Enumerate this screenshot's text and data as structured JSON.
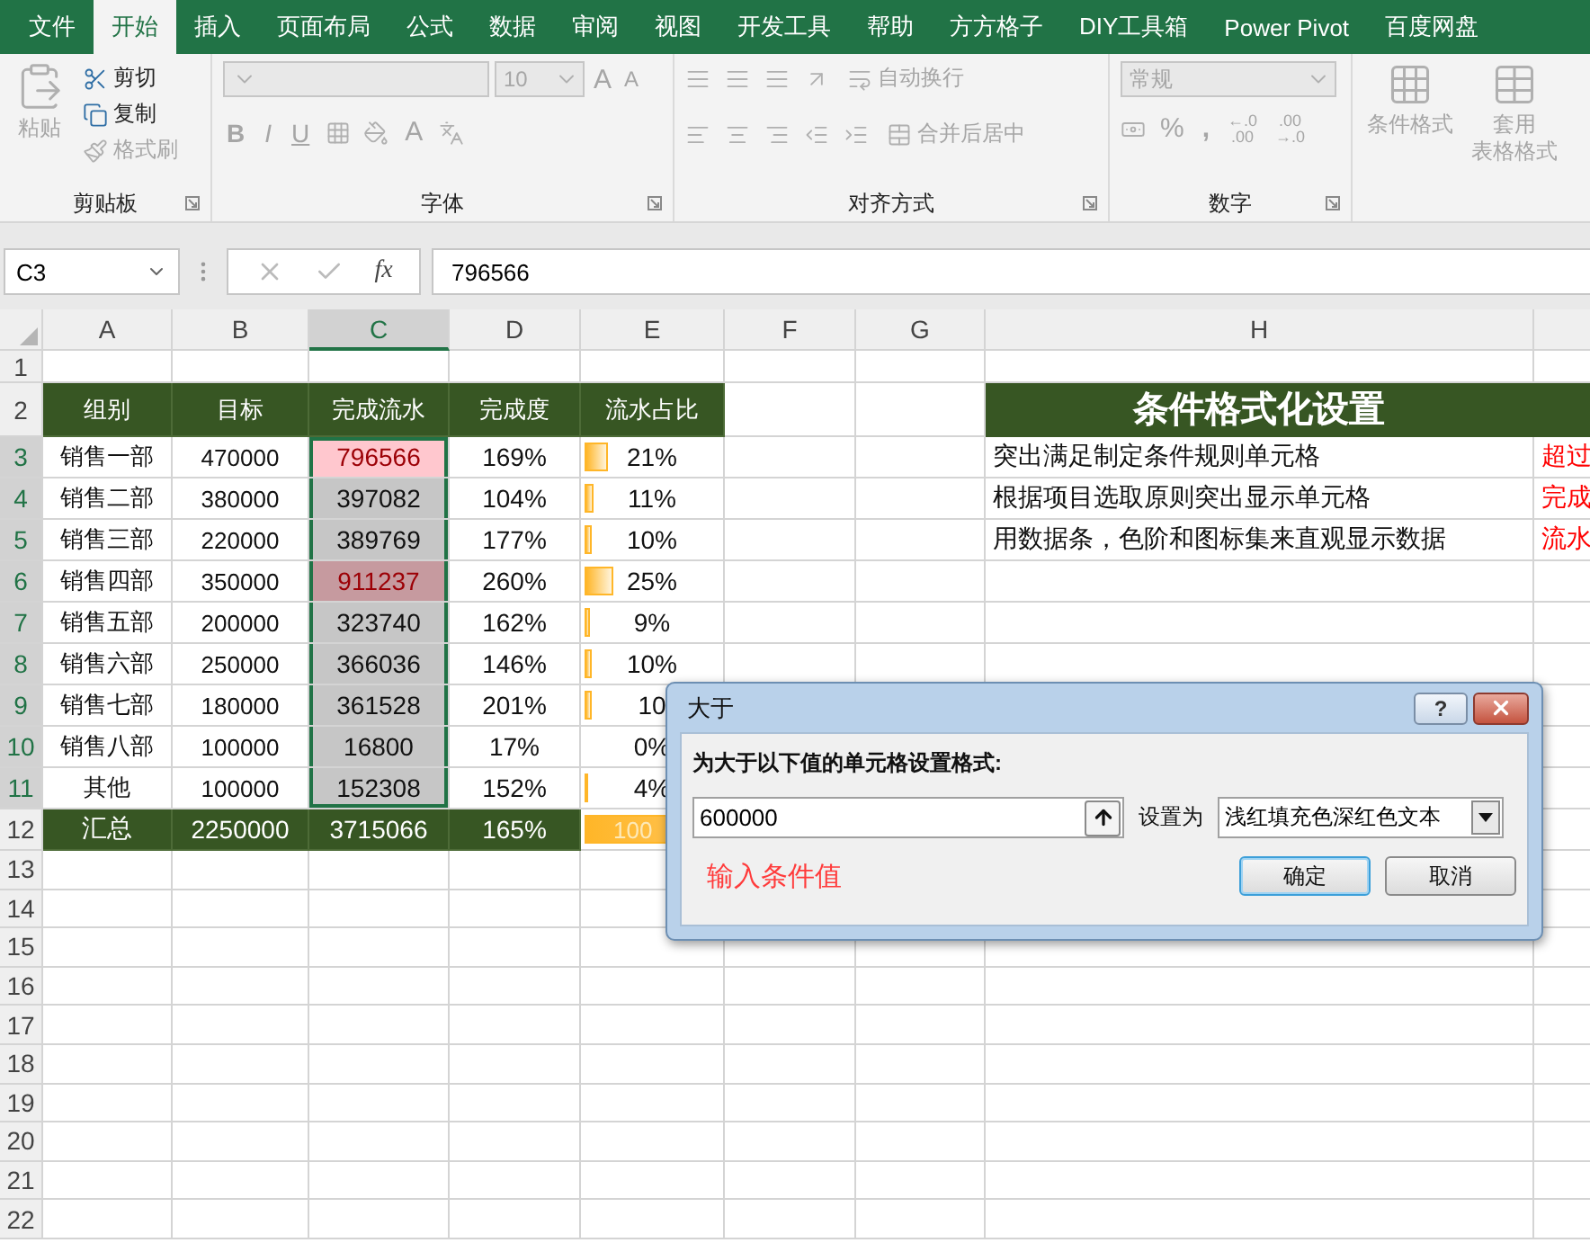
{
  "ribbon_tabs": [
    {
      "label": "文件",
      "selected": false
    },
    {
      "label": "开始",
      "selected": true
    },
    {
      "label": "插入",
      "selected": false
    },
    {
      "label": "页面布局",
      "selected": false
    },
    {
      "label": "公式",
      "selected": false
    },
    {
      "label": "数据",
      "selected": false
    },
    {
      "label": "审阅",
      "selected": false
    },
    {
      "label": "视图",
      "selected": false
    },
    {
      "label": "开发工具",
      "selected": false
    },
    {
      "label": "帮助",
      "selected": false
    },
    {
      "label": "方方格子",
      "selected": false
    },
    {
      "label": "DIY工具箱",
      "selected": false
    },
    {
      "label": "Power Pivot",
      "selected": false
    },
    {
      "label": "百度网盘",
      "selected": false
    }
  ],
  "ribbon": {
    "clipboard": {
      "title": "剪贴板",
      "paste": {
        "label": "粘贴",
        "disabled": true
      },
      "actions": [
        {
          "kind": "cut",
          "label": "剪切",
          "disabled": false
        },
        {
          "kind": "copy",
          "label": "复制",
          "disabled": false
        },
        {
          "kind": "painter",
          "label": "格式刷",
          "disabled": true
        }
      ]
    },
    "font": {
      "title": "字体",
      "size": "10",
      "grow": "A",
      "shrink": "A",
      "styles": [
        "B",
        "I",
        "U"
      ],
      "font_color": "A"
    },
    "alignment": {
      "title": "对齐方式",
      "wrap": "自动换行",
      "merge": "合并后居中"
    },
    "number": {
      "title": "数字",
      "format": "常规",
      "percent": "%",
      "comma": ",",
      "decimals": [
        {
          "top": "←.0",
          "bottom": ".00"
        },
        {
          "top": ".00",
          "bottom": "→.0"
        }
      ]
    },
    "styles": [
      {
        "kind": "conditional",
        "lines": [
          "条件格式"
        ]
      },
      {
        "kind": "table",
        "lines": [
          "套用",
          "表格格式"
        ]
      }
    ]
  },
  "name_box": "C3",
  "formula": {
    "fx": "fx",
    "value": "796566"
  },
  "sheet": {
    "columns": [
      {
        "label": "A",
        "selected": false
      },
      {
        "label": "B",
        "selected": false
      },
      {
        "label": "C",
        "selected": true
      },
      {
        "label": "D",
        "selected": false
      },
      {
        "label": "E",
        "selected": false
      },
      {
        "label": "F",
        "selected": false
      },
      {
        "label": "G",
        "selected": false
      },
      {
        "label": "H",
        "selected": false
      }
    ],
    "rows": [
      {
        "number": "1",
        "kind": "empty",
        "selected": false
      },
      {
        "number": "2",
        "kind": "header",
        "selected": false,
        "cells": [
          "组别",
          "目标",
          "完成流水",
          "完成度",
          "流水占比"
        ],
        "h": "条件格式化设置"
      },
      {
        "number": "3",
        "kind": "data",
        "selected": true,
        "a": "销售一部",
        "b": "470000",
        "c": {
          "text": "796566",
          "highlight": true,
          "active": true
        },
        "d": "169%",
        "e": {
          "text": "21%",
          "level": 0.21
        },
        "h": "突出满足制定条件规则单元格",
        "i": "超过"
      },
      {
        "number": "4",
        "kind": "data",
        "selected": true,
        "a": "销售二部",
        "b": "380000",
        "c": {
          "text": "397082",
          "highlight": false,
          "active": false
        },
        "d": "104%",
        "e": {
          "text": "11%",
          "level": 0.11
        },
        "h": "根据项目选取原则突出显示单元格",
        "i": "完成"
      },
      {
        "number": "5",
        "kind": "data",
        "selected": true,
        "a": "销售三部",
        "b": "220000",
        "c": {
          "text": "389769",
          "highlight": false,
          "active": false
        },
        "d": "177%",
        "e": {
          "text": "10%",
          "level": 0.1
        },
        "h": "用数据条，色阶和图标集来直观显示数据",
        "i": "流水"
      },
      {
        "number": "6",
        "kind": "data",
        "selected": true,
        "a": "销售四部",
        "b": "350000",
        "c": {
          "text": "911237",
          "highlight": true,
          "active": false
        },
        "d": "260%",
        "e": {
          "text": "25%",
          "level": 0.25
        }
      },
      {
        "number": "7",
        "kind": "data",
        "selected": true,
        "a": "销售五部",
        "b": "200000",
        "c": {
          "text": "323740",
          "highlight": false,
          "active": false
        },
        "d": "162%",
        "e": {
          "text": "9%",
          "level": 0.09
        }
      },
      {
        "number": "8",
        "kind": "data",
        "selected": true,
        "a": "销售六部",
        "b": "250000",
        "c": {
          "text": "366036",
          "highlight": false,
          "active": false
        },
        "d": "146%",
        "e": {
          "text": "10%",
          "level": 0.1
        }
      },
      {
        "number": "9",
        "kind": "data",
        "selected": true,
        "a": "销售七部",
        "b": "180000",
        "c": {
          "text": "361528",
          "highlight": false,
          "active": false
        },
        "d": "201%",
        "e": {
          "text": "10",
          "level": 0.1
        }
      },
      {
        "number": "10",
        "kind": "data",
        "selected": true,
        "a": "销售八部",
        "b": "100000",
        "c": {
          "text": "16800",
          "highlight": false,
          "active": false
        },
        "d": "17%",
        "e": {
          "text": "0%"
        }
      },
      {
        "number": "11",
        "kind": "data",
        "selected": true,
        "a": "其他",
        "b": "100000",
        "c": {
          "text": "152308",
          "highlight": false,
          "active": false
        },
        "d": "152%",
        "e": {
          "text": "4%",
          "level": 0.04
        }
      },
      {
        "number": "12",
        "kind": "total",
        "selected": false,
        "cells": [
          "汇总",
          "2250000",
          "3715066",
          "165%"
        ],
        "e": {
          "text": "100",
          "level": 1
        }
      },
      {
        "number": "13",
        "kind": "empty",
        "selected": false
      },
      {
        "number": "14",
        "kind": "empty",
        "selected": false
      },
      {
        "number": "15",
        "kind": "empty",
        "selected": false
      },
      {
        "number": "16",
        "kind": "empty",
        "selected": false
      },
      {
        "number": "17",
        "kind": "empty",
        "selected": false
      },
      {
        "number": "18",
        "kind": "empty",
        "selected": false
      },
      {
        "number": "19",
        "kind": "empty",
        "selected": false
      },
      {
        "number": "20",
        "kind": "empty",
        "selected": false
      },
      {
        "number": "21",
        "kind": "empty",
        "selected": false
      },
      {
        "number": "22",
        "kind": "empty",
        "selected": false
      }
    ]
  },
  "dialog": {
    "title": "大于",
    "help": "?",
    "prompt": "为大于以下值的单元格设置格式:",
    "value": "600000",
    "set_label": "设置为",
    "format": "浅红填充色深红色文本",
    "note": "输入条件值",
    "buttons": [
      {
        "label": "确定",
        "default": true
      },
      {
        "label": "取消",
        "default": false
      }
    ]
  }
}
